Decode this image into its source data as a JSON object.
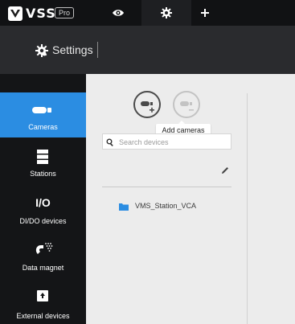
{
  "app": {
    "brand": "VSS",
    "edition": "Pro"
  },
  "top_tabs": [
    {
      "name": "live",
      "icon": "eye-icon"
    },
    {
      "name": "settings",
      "icon": "gear-icon",
      "active": true
    },
    {
      "name": "add",
      "icon": "plus-icon",
      "label": "+"
    }
  ],
  "header": {
    "title": "Settings",
    "icon": "gear-icon"
  },
  "sidebar": {
    "items": [
      {
        "label": "Cameras",
        "icon": "camera-icon",
        "active": true
      },
      {
        "label": "Stations",
        "icon": "server-icon"
      },
      {
        "label": "DI/DO devices",
        "icon_text": "I/O"
      },
      {
        "label": "Data magnet",
        "icon": "magnet-icon"
      },
      {
        "label": "External devices",
        "icon": "external-device-icon"
      }
    ]
  },
  "main": {
    "add_camera_tooltip": "Add cameras",
    "search": {
      "placeholder": "Search devices",
      "value": ""
    },
    "tree": [
      {
        "label": "VMS_Station_VCA",
        "icon": "folder-icon"
      }
    ]
  },
  "colors": {
    "accent": "#2b8de2",
    "topbar": "#111214",
    "header": "#2a2b2e",
    "sidebar": "#141517",
    "main_bg": "#ececec"
  }
}
